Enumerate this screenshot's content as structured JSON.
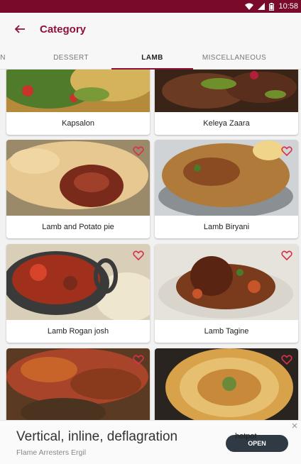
{
  "status_bar": {
    "time": "10:58"
  },
  "app_bar": {
    "title": "Category"
  },
  "tabs": [
    {
      "label": "N"
    },
    {
      "label": "DESSERT"
    },
    {
      "label": "LAMB"
    },
    {
      "label": "MISCELLANEOUS"
    }
  ],
  "active_tab": "LAMB",
  "recipes": [
    {
      "name": "Kapsalon"
    },
    {
      "name": "Keleya Zaara"
    },
    {
      "name": "Lamb and Potato pie"
    },
    {
      "name": "Lamb Biryani"
    },
    {
      "name": "Lamb Rogan josh"
    },
    {
      "name": "Lamb Tagine"
    }
  ],
  "ad": {
    "title": "Vertical, inline, deflagration",
    "subtitle": "Flame Arresters Ergil",
    "button_label": "OPEN",
    "overlay_text": "hotpot"
  },
  "colors": {
    "primary": "#7a0a2a",
    "accent": "#8b1238",
    "heart": "#d8324a"
  }
}
